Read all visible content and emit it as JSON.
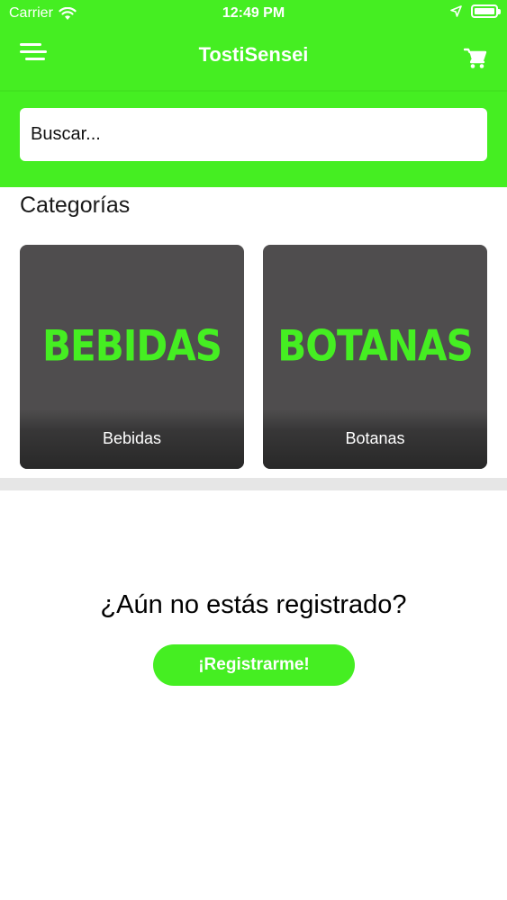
{
  "status_bar": {
    "carrier": "Carrier",
    "time": "12:49 PM",
    "icons": [
      "wifi-icon",
      "location-arrow-icon",
      "battery-icon"
    ]
  },
  "nav": {
    "title": "TostiSensei",
    "left_icon": "menu-icon",
    "right_icon": "cart-icon"
  },
  "search": {
    "placeholder": "Buscar..."
  },
  "categories": {
    "title": "Categorías",
    "items": [
      {
        "image_text": "BEBIDAS",
        "label": "Bebidas"
      },
      {
        "image_text": "BOTANAS",
        "label": "Botanas"
      }
    ]
  },
  "register": {
    "question": "¿Aún no estás registrado?",
    "button_label": "¡Registrarme!"
  },
  "colors": {
    "accent": "#45ee22",
    "card_bg": "#4f4d4e",
    "separator": "#e6e6e6"
  }
}
